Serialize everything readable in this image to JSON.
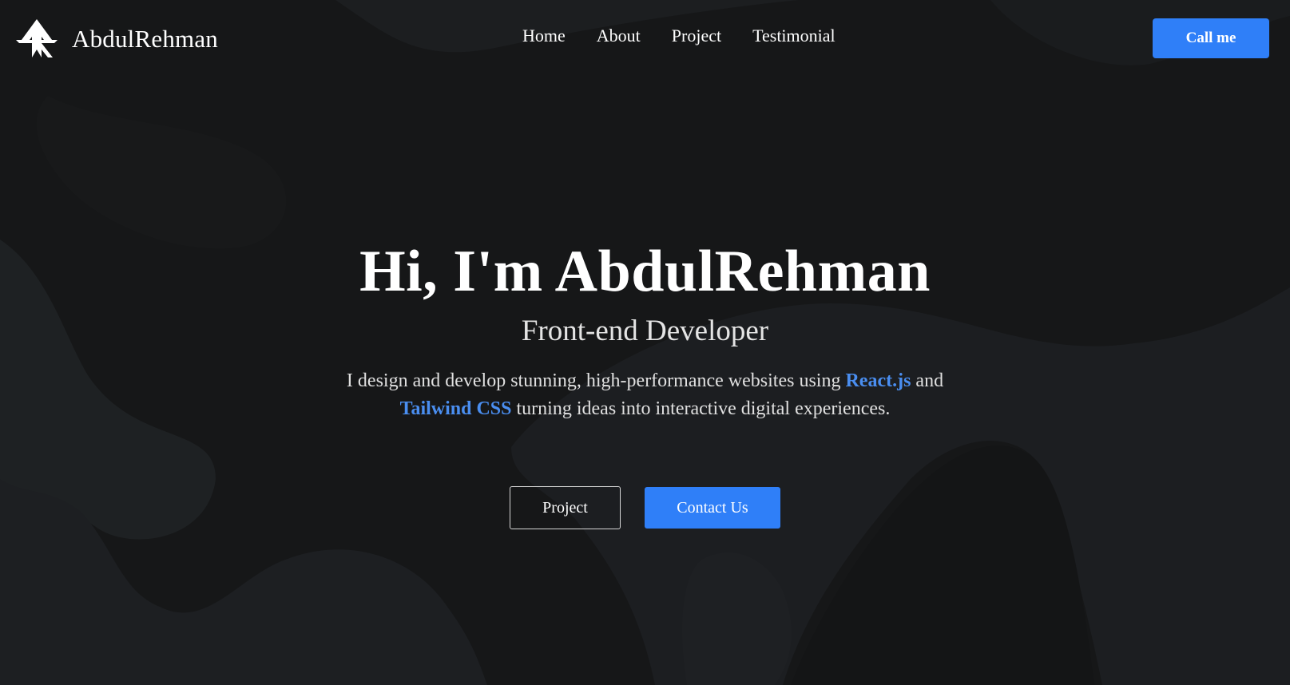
{
  "brand": {
    "name": "AbdulRehman",
    "logo_icon": "ar-monogram-icon"
  },
  "nav": {
    "items": [
      {
        "label": "Home"
      },
      {
        "label": "About"
      },
      {
        "label": "Project"
      },
      {
        "label": "Testimonial"
      }
    ],
    "cta_label": "Call me"
  },
  "hero": {
    "title": "Hi, I'm AbdulRehman",
    "subtitle": "Front-end Developer",
    "description": {
      "part1": "I design and develop stunning, high-performance websites using ",
      "highlight1": "React.js",
      "part2": " and ",
      "highlight2": "Tailwind CSS",
      "part3": " turning ideas into interactive digital experiences."
    },
    "buttons": {
      "project_label": "Project",
      "contact_label": "Contact Us"
    }
  },
  "colors": {
    "accent": "#2f7ff8",
    "highlight_text": "#4a8ef0",
    "background": "#141516"
  }
}
